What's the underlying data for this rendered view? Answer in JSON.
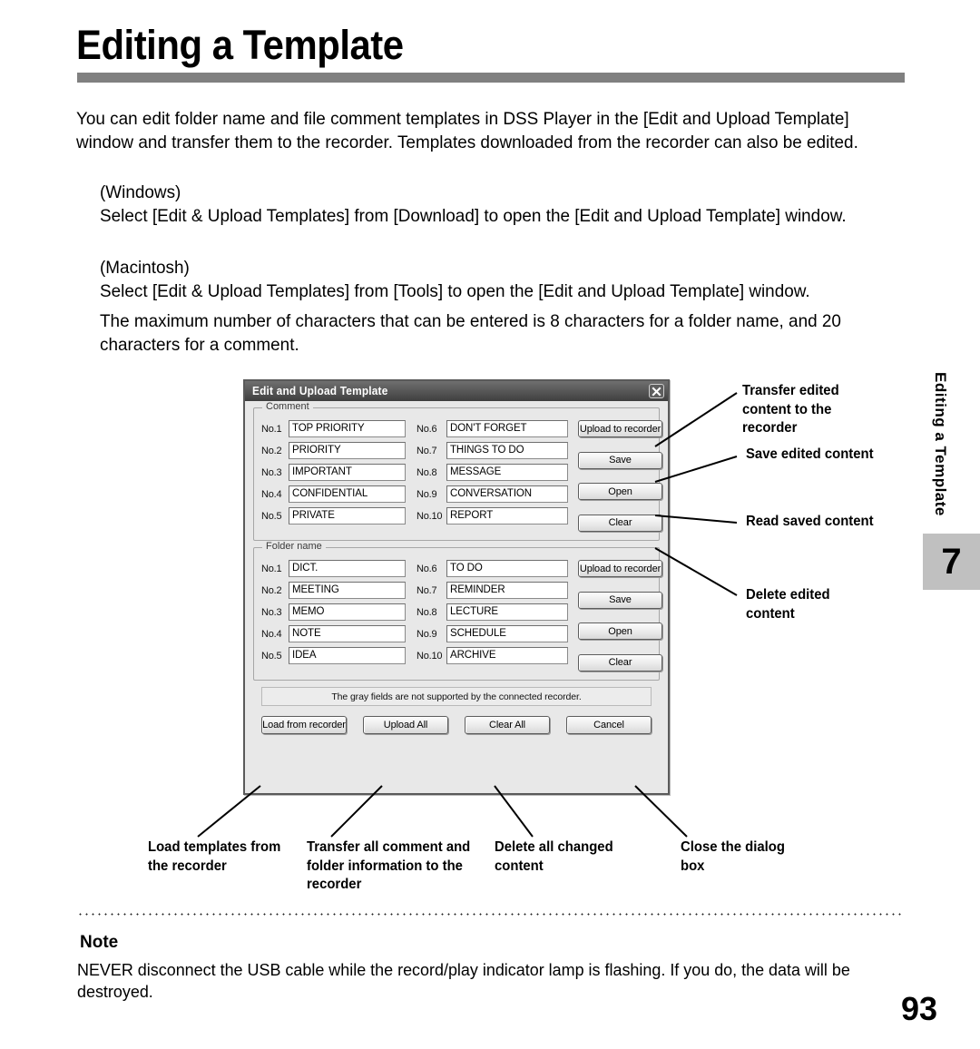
{
  "page": {
    "title": "Editing a Template",
    "side_label": "Editing a Template",
    "chapter_number": "7",
    "page_number": "93",
    "intro": "You can edit folder name and file comment templates in DSS Player in the [Edit and Upload Template] window and transfer them to the recorder. Templates downloaded from the recorder can also be edited.",
    "windows_block": "(Windows)\nSelect [Edit & Upload Templates] from [Download] to open the [Edit and Upload Template] window.",
    "macintosh_block": "(Macintosh)\nSelect [Edit & Upload Templates] from [Tools] to open the [Edit and Upload Template] window.",
    "max_chars": "The maximum number of characters that can be entered is 8 characters for a folder name, and 20 characters for a comment."
  },
  "dialog": {
    "title": "Edit and Upload Template",
    "close_icon": "close-icon",
    "comment_group": {
      "legend": "Comment",
      "left_column": [
        {
          "no": "No.1",
          "value": "TOP PRIORITY"
        },
        {
          "no": "No.2",
          "value": "PRIORITY"
        },
        {
          "no": "No.3",
          "value": "IMPORTANT"
        },
        {
          "no": "No.4",
          "value": "CONFIDENTIAL"
        },
        {
          "no": "No.5",
          "value": "PRIVATE"
        }
      ],
      "right_column": [
        {
          "no": "No.6",
          "value": "DON'T FORGET"
        },
        {
          "no": "No.7",
          "value": "THINGS TO DO"
        },
        {
          "no": "No.8",
          "value": "MESSAGE"
        },
        {
          "no": "No.9",
          "value": "CONVERSATION"
        },
        {
          "no": "No.10",
          "value": "REPORT"
        }
      ],
      "buttons": [
        "Upload to recorder",
        "Save",
        "Open",
        "Clear"
      ]
    },
    "folder_group": {
      "legend": "Folder name",
      "left_column": [
        {
          "no": "No.1",
          "value": "DICT."
        },
        {
          "no": "No.2",
          "value": "MEETING"
        },
        {
          "no": "No.3",
          "value": "MEMO"
        },
        {
          "no": "No.4",
          "value": "NOTE"
        },
        {
          "no": "No.5",
          "value": "IDEA"
        }
      ],
      "right_column": [
        {
          "no": "No.6",
          "value": "TO DO"
        },
        {
          "no": "No.7",
          "value": "REMINDER"
        },
        {
          "no": "No.8",
          "value": "LECTURE"
        },
        {
          "no": "No.9",
          "value": "SCHEDULE"
        },
        {
          "no": "No.10",
          "value": "ARCHIVE"
        }
      ],
      "buttons": [
        "Upload to recorder",
        "Save",
        "Open",
        "Clear"
      ]
    },
    "gray_note": "The gray fields are not supported by the connected recorder.",
    "bottom_buttons": [
      "Load from recorder",
      "Upload All",
      "Clear All",
      "Cancel"
    ]
  },
  "callouts": {
    "right": [
      "Transfer edited content to the recorder",
      "Save edited content",
      "Read saved content",
      "Delete edited content"
    ],
    "bottom": [
      "Load templates from the recorder",
      "Transfer all comment and folder information to the recorder",
      "Delete all changed content",
      "Close the dialog box"
    ]
  },
  "note": {
    "heading": "Note",
    "body": "NEVER disconnect the USB cable while the record/play indicator lamp is flashing. If you do, the data will be destroyed."
  },
  "colors": {
    "rule": "#808080",
    "chapter_tab": "#c0c0c0",
    "dialog_face": "#e8e8e8",
    "titlebar": "#4a4a4a"
  }
}
